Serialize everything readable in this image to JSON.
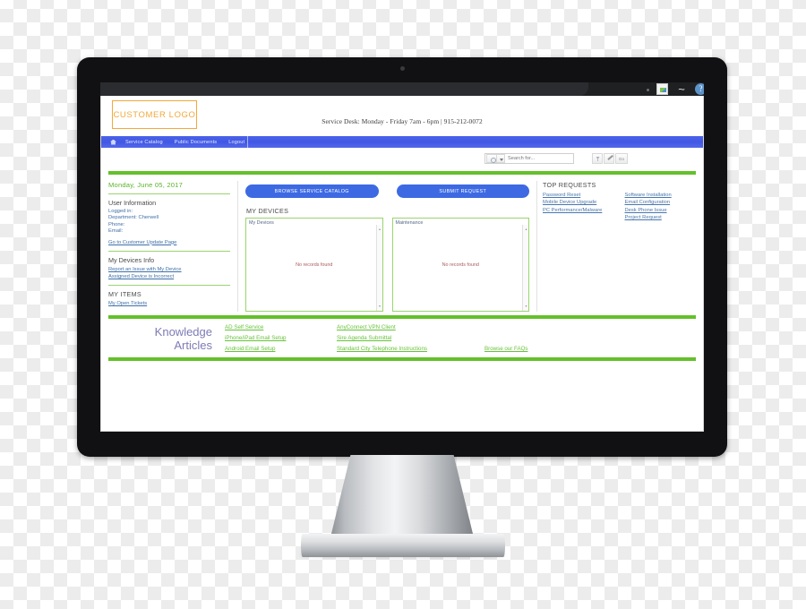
{
  "browser": {
    "image_icon": "image-icon",
    "swoosh_icon": "swoosh-icon",
    "help_icon": "?"
  },
  "header": {
    "logo_text": "CUSTOMER LOGO",
    "service_desk_info": "Service Desk: Monday - Friday 7am - 6pm | 915-212-0072"
  },
  "nav": {
    "home_icon": "home-icon",
    "items": [
      {
        "label": "Service Catalog"
      },
      {
        "label": "Public Documents"
      },
      {
        "label": "Logout"
      }
    ]
  },
  "search": {
    "placeholder": "Search for...",
    "scope_icon": "magnifier-icon",
    "caret_icon": "chevron-down-icon",
    "filter_icon": "filter-icon",
    "pencil_icon": "pencil-icon",
    "go_label": "Go"
  },
  "sidebar": {
    "date": "Monday, June 05, 2017",
    "user_information_heading": "User Information",
    "user_fields": [
      "Logged in:",
      "Department: Cherwell",
      "Phone:",
      "Email:"
    ],
    "customer_update_link": "Go to Customer Update Page",
    "devices_info_heading": "My Devices Info",
    "devices_info_links": [
      "Report an Issue with My Device",
      "Assigned Device is Incorrect"
    ],
    "my_items_heading": "MY ITEMS",
    "my_items_links": [
      "My Open Tickets"
    ]
  },
  "center": {
    "browse_catalog_label": "BROWSE SERVICE CATALOG",
    "submit_request_label": "SUBMIT REQUEST",
    "my_devices_title": "MY DEVICES",
    "panels": [
      {
        "title": "My Devices",
        "empty_text": "No records found",
        "scroll_up": "▴",
        "scroll_down": "▾"
      },
      {
        "title": "Maintenance",
        "empty_text": "No records found",
        "scroll_up": "▴",
        "scroll_down": "▾"
      }
    ]
  },
  "top_requests": {
    "title": "TOP REQUESTS",
    "column_one": [
      "Password Reset",
      "Mobile Device Upgrade",
      "PC Performance/Malware"
    ],
    "column_two": [
      "Software Installation",
      "Email Configuration",
      "Desk Phone Issue",
      "Project Request"
    ]
  },
  "knowledge": {
    "title_line_one": "Knowledge",
    "title_line_two": "Articles",
    "col_one": [
      "AD Self Service",
      "iPhone/iPad Email Setup",
      "Android Email Setup"
    ],
    "col_two": [
      "AnyConnect VPN Client",
      "Sire Agenda Submittal",
      "Standard City Telephone Instructions"
    ],
    "col_three": [
      "Browse our FAQs"
    ]
  },
  "colors": {
    "green_rule": "#64c02b",
    "nav_blue": "#4058e4",
    "button_blue": "#3d6ae3",
    "logo_orange": "#f2a93b",
    "knowledge_purple": "#7d7bb5",
    "link_blue": "#4a76ad",
    "kb_green": "#68c23c"
  }
}
